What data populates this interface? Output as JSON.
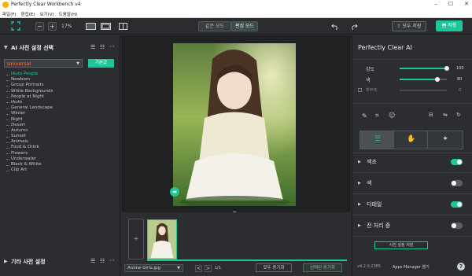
{
  "window": {
    "title": "Perfectly Clear Workbench v4",
    "min": "–",
    "max": "☐",
    "close": "✕"
  },
  "menu": [
    "파일(F)",
    "편집(E)",
    "보기(V)",
    "도움말(H)"
  ],
  "toolbar": {
    "zoom_minus": "−",
    "zoom_plus": "+",
    "zoom_value": "17%",
    "mode_tabs": [
      {
        "label": "같은 모드",
        "active": false
      },
      {
        "label": "편집 모드",
        "active": true
      }
    ],
    "export_label": "모두 저장",
    "save_label": "저장"
  },
  "left_panel": {
    "ai_presets_header": "AI 사전 설정 선택",
    "preset_select_value": "Universal",
    "apply_label": "기본값",
    "presets": [
      {
        "label": "iAuto People",
        "active": true
      },
      {
        "label": "Newborn"
      },
      {
        "label": "Group Portraits"
      },
      {
        "label": "White Backgrounds"
      },
      {
        "label": "People at Night"
      },
      {
        "label": "iAuto"
      },
      {
        "label": "General Landscape"
      },
      {
        "label": "Winter"
      },
      {
        "label": "Night"
      },
      {
        "label": "Desert"
      },
      {
        "label": "Autumn"
      },
      {
        "label": "Sunset"
      },
      {
        "label": "Animals"
      },
      {
        "label": "Food & Drink"
      },
      {
        "label": "Flowers"
      },
      {
        "label": "Underwater"
      },
      {
        "label": "Black & White"
      },
      {
        "label": "Clip Art"
      }
    ],
    "other_presets_header": "기타 사전 설정"
  },
  "canvas": {
    "handle_label": "◀▶",
    "collapse_arrow": "▼"
  },
  "filmstrip": {
    "add_label": "+"
  },
  "bottom_bar": {
    "filename": "Anime Girls.jpg",
    "page_prev": "<",
    "page_next": ">",
    "page_value": "1/1",
    "sync_all": "모두 동기화",
    "sync_selected": "선택된 동기화"
  },
  "right_panel": {
    "title": "Perfectly Clear AI",
    "sliders": [
      {
        "label": "강도",
        "value": "100",
        "fraction": 1.0
      },
      {
        "label": "색",
        "value": "80",
        "fraction": 0.8
      },
      {
        "label": "피부색",
        "value": "0",
        "fraction": 0.0
      }
    ],
    "sections": [
      {
        "label": "색조",
        "on": true
      },
      {
        "label": "색",
        "on": false
      },
      {
        "label": "디테일",
        "on": true
      },
      {
        "label": "전 처리 중",
        "on": false
      }
    ],
    "save_preset_label": "사전 설정 저장",
    "version": "v4.2.0.2385",
    "apps_manager": "Apps Manager 열기",
    "help": "?"
  },
  "colors": {
    "accent": "#1ec79a",
    "preset_select_text": "#f06b4a",
    "bg": "#2b2d30"
  }
}
